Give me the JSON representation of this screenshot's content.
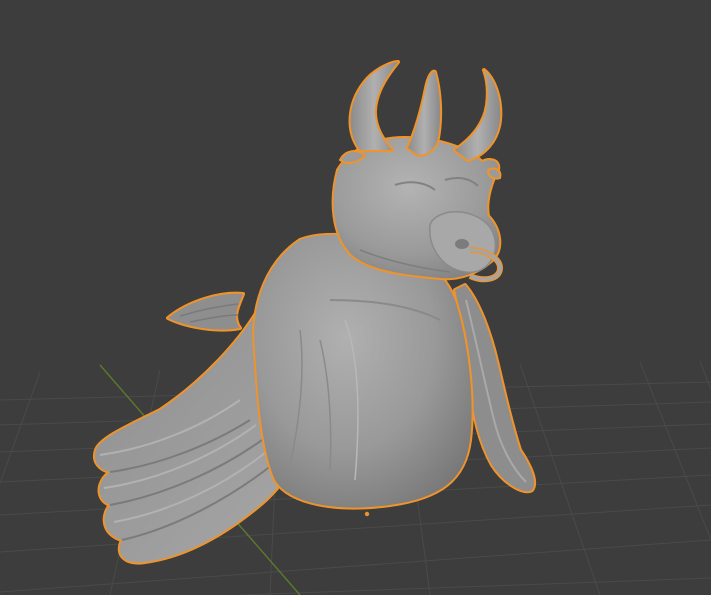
{
  "viewport": {
    "background_color": "#3d3d3d",
    "grid_color": "#4a4a4a",
    "x_axis_color": "#8a3b3b",
    "y_axis_color": "#5b7a2b",
    "selection_outline_color": "#f0932a",
    "object_color": "#9c9c9c",
    "show_grid": true,
    "object_selected": true,
    "origin_marker_color": "#f0932a"
  },
  "scene_object": {
    "icon": "sculpted-bull-bird-mesh-icon",
    "features": [
      "horns",
      "nose-ring",
      "tail-feathers",
      "wing",
      "body"
    ]
  }
}
